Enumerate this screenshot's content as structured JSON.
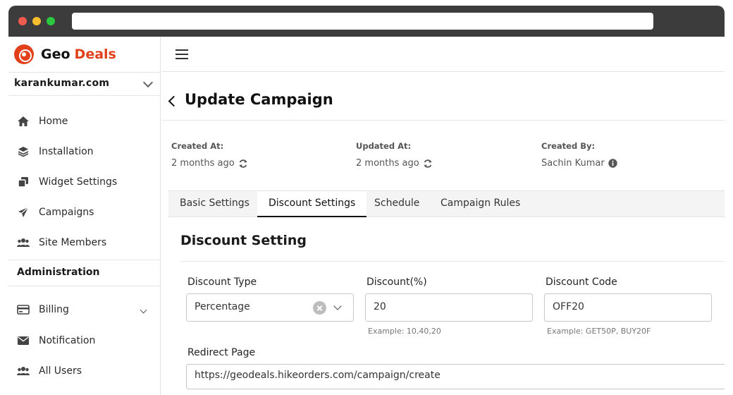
{
  "brand": {
    "name_part1": "Geo",
    "name_part2": "Deals",
    "accent_color": "#e2401a"
  },
  "site_selector": {
    "value": "karankumar.com"
  },
  "sidebar": {
    "items": [
      {
        "label": "Home",
        "icon": "home-icon"
      },
      {
        "label": "Installation",
        "icon": "layers-icon"
      },
      {
        "label": "Widget Settings",
        "icon": "widgets-icon"
      },
      {
        "label": "Campaigns",
        "icon": "paper-plane-icon"
      },
      {
        "label": "Site Members",
        "icon": "users-icon"
      }
    ],
    "section_label": "Administration",
    "admin_items": [
      {
        "label": "Billing",
        "icon": "credit-card-icon",
        "expandable": true
      },
      {
        "label": "Notification",
        "icon": "envelope-icon"
      },
      {
        "label": "All Users",
        "icon": "users-icon"
      }
    ]
  },
  "page": {
    "title": "Update Campaign"
  },
  "meta": {
    "created_at_label": "Created At:",
    "created_at_value": "2 months ago",
    "updated_at_label": "Updated At:",
    "updated_at_value": "2 months ago",
    "created_by_label": "Created By:",
    "created_by_value": "Sachin Kumar"
  },
  "tabs": [
    {
      "label": "Basic Settings",
      "active": false
    },
    {
      "label": "Discount Settings",
      "active": true
    },
    {
      "label": "Schedule",
      "active": false
    },
    {
      "label": "Campaign Rules",
      "active": false
    }
  ],
  "discount": {
    "section_title": "Discount Setting",
    "type_label": "Discount Type",
    "type_value": "Percentage",
    "percent_label": "Discount(%)",
    "percent_value": "20",
    "percent_hint": "Example: 10,40,20",
    "code_label": "Discount Code",
    "code_value": "OFF20",
    "code_hint": "Example: GET50P, BUY20F",
    "redirect_label": "Redirect Page",
    "redirect_value": "https://geodeals.hikeorders.com/campaign/create"
  }
}
